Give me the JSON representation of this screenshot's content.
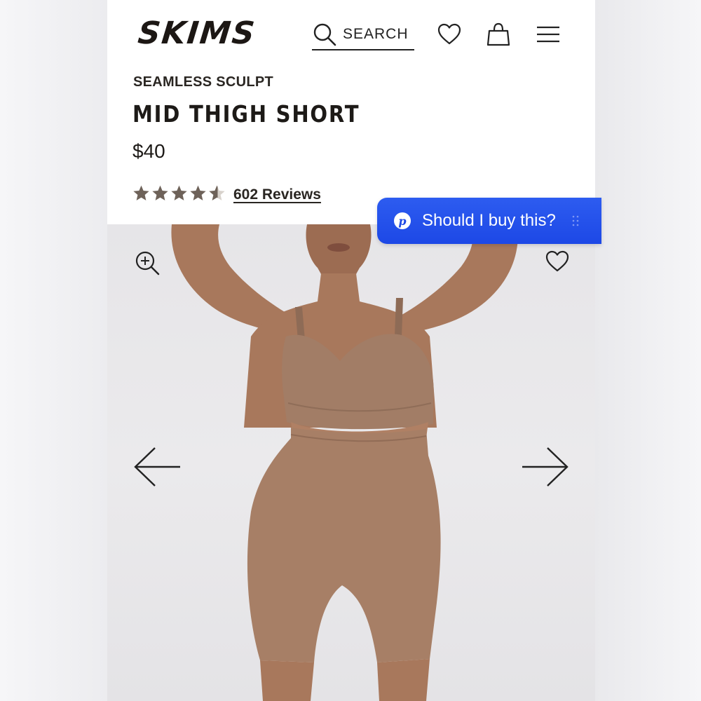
{
  "header": {
    "logo": "SKIMS",
    "search_label": "SEARCH",
    "icons": [
      "search-icon",
      "heart-icon",
      "bag-icon",
      "menu-icon"
    ]
  },
  "product": {
    "collection": "SEAMLESS SCULPT",
    "name": "MID THIGH SHORT",
    "price": "$40",
    "rating": 4.5,
    "rating_max": 5,
    "reviews_label": "602 Reviews"
  },
  "gallery": {
    "icons": [
      "zoom-in-icon",
      "heart-icon",
      "arrow-left-icon",
      "arrow-right-icon"
    ]
  },
  "assistant": {
    "logo": "p",
    "label": "Should I buy this?"
  },
  "colors": {
    "assistant_blue": "#1d48e6",
    "text_dark": "#1d1a17",
    "star": "#6e6259",
    "garment": "#a77f66"
  }
}
